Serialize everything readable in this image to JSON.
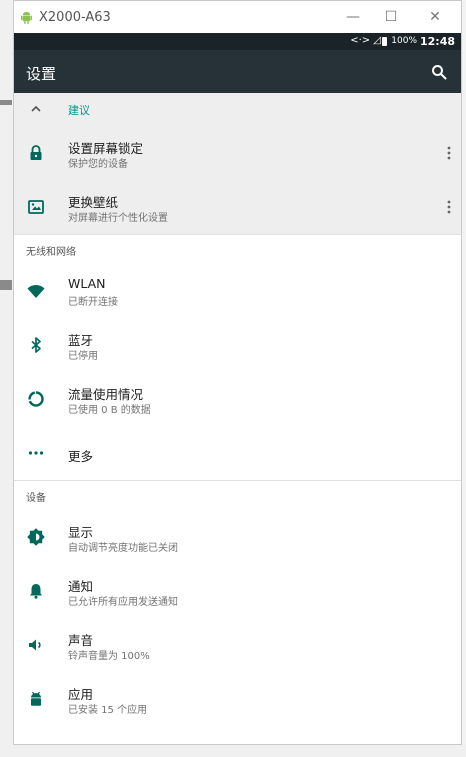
{
  "window": {
    "title": "X2000-A63",
    "minimize": "—",
    "maximize": "☐",
    "close": "✕"
  },
  "status_bar": {
    "icons": "<·> ◿",
    "battery": "100%",
    "time": "12:48"
  },
  "toolbar": {
    "title": "设置",
    "search_icon": "search-icon"
  },
  "suggestions": {
    "header": "建议",
    "items": [
      {
        "title": "设置屏幕锁定",
        "subtitle": "保护您的设备",
        "icon": "lock-icon"
      },
      {
        "title": "更换壁纸",
        "subtitle": "对屏幕进行个性化设置",
        "icon": "wallpaper-icon"
      }
    ]
  },
  "sections": [
    {
      "header": "无线和网络",
      "items": [
        {
          "title": "WLAN",
          "subtitle": "已断开连接",
          "icon": "wifi-icon"
        },
        {
          "title": "蓝牙",
          "subtitle": "已停用",
          "icon": "bluetooth-icon"
        },
        {
          "title": "流量使用情况",
          "subtitle": "已使用 0 B 的数据",
          "icon": "data-usage-icon"
        },
        {
          "title": "更多",
          "subtitle": "",
          "icon": "more-horiz-icon"
        }
      ]
    },
    {
      "header": "设备",
      "items": [
        {
          "title": "显示",
          "subtitle": "自动调节亮度功能已关闭",
          "icon": "brightness-icon"
        },
        {
          "title": "通知",
          "subtitle": "已允许所有应用发送通知",
          "icon": "bell-icon"
        },
        {
          "title": "声音",
          "subtitle": "铃声音量为 100%",
          "icon": "volume-icon"
        },
        {
          "title": "应用",
          "subtitle": "已安装 15 个应用",
          "icon": "android-icon"
        }
      ]
    }
  ],
  "colors": {
    "accent": "#009688",
    "toolbar": "#263238",
    "statusbar": "#1a2428",
    "icon": "#00695c"
  }
}
